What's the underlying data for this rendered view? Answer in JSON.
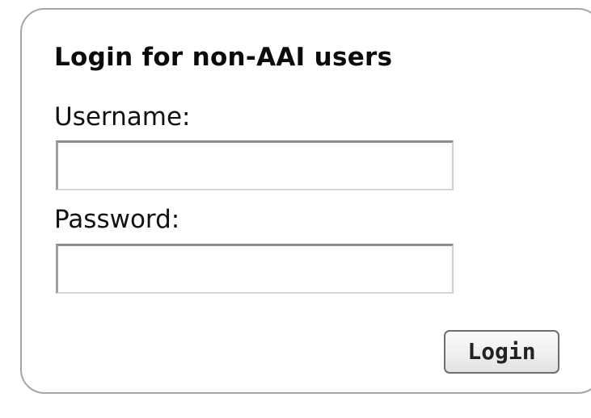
{
  "login_form": {
    "title": "Login for non-AAI users",
    "username_label": "Username:",
    "username_value": "",
    "password_label": "Password:",
    "password_value": "",
    "submit_label": "Login"
  }
}
